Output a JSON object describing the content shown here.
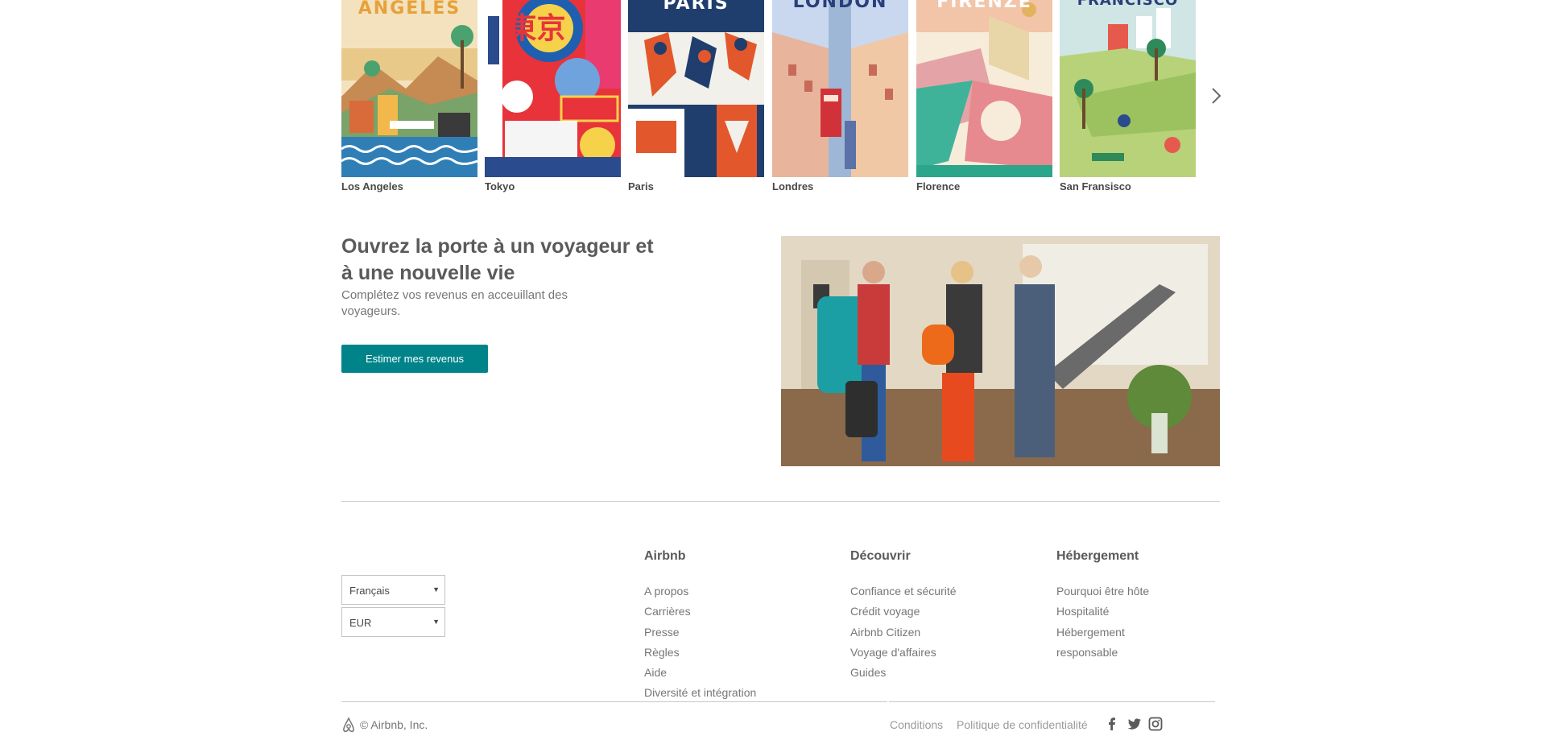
{
  "cities": [
    {
      "name": "Los Angeles",
      "poster_title": "ANGELES"
    },
    {
      "name": "Tokyo",
      "poster_title": "東京"
    },
    {
      "name": "Paris",
      "poster_title": "PARIS"
    },
    {
      "name": "Londres",
      "poster_title": "LONDON"
    },
    {
      "name": "Florence",
      "poster_title": "FIRENZE"
    },
    {
      "name": "San Fransisco",
      "poster_title": "FRANCISCO"
    }
  ],
  "host": {
    "title": "Ouvrez la porte à un voyageur et à une nouvelle vie",
    "subtitle": "Complétez vos revenus en acceuillant des voyageurs.",
    "cta_label": "Estimer mes revenus"
  },
  "footer": {
    "language": "Français",
    "currency": "EUR",
    "columns": [
      {
        "heading": "Airbnb",
        "links": [
          "A propos",
          "Carrières",
          "Presse",
          "Règles",
          "Aide",
          "Diversité et intégration"
        ]
      },
      {
        "heading": "Découvrir",
        "links": [
          "Confiance et sécurité",
          "Crédit voyage",
          "Airbnb Citizen",
          "Voyage d'affaires",
          "Guides"
        ]
      },
      {
        "heading": "Hébergement",
        "links": [
          "Pourquoi être hôte",
          "Hospitalité",
          "Hébergement",
          "responsable"
        ]
      }
    ],
    "copyright": "© Airbnb, Inc.",
    "bottom_links": {
      "terms": "Conditions",
      "privacy": "Politique de confidentialité"
    },
    "social_icons": [
      "facebook-icon",
      "twitter-icon",
      "instagram-icon"
    ]
  },
  "colors": {
    "accent": "#00848a",
    "text": "#484848",
    "muted": "#767676"
  }
}
